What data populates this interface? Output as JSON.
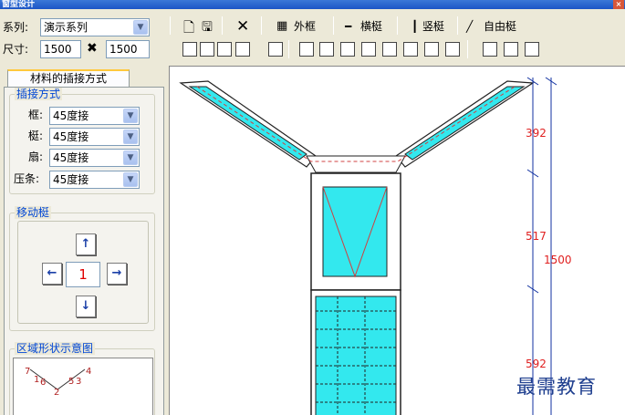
{
  "window": {
    "title": "窗型设计",
    "close": "×"
  },
  "series": {
    "label": "系列:",
    "value": "演示系列"
  },
  "size": {
    "label": "尺寸:",
    "width": "1500",
    "times": "✖",
    "height": "1500"
  },
  "toolbar": {
    "outer_frame": "外框",
    "horizontal": "横梃",
    "vertical": "竖梃",
    "free": "自由梃"
  },
  "tab": {
    "label": "材料的插接方式"
  },
  "joins": {
    "title": "插接方式",
    "rows": [
      {
        "label": "框:",
        "value": "45度接"
      },
      {
        "label": "梃:",
        "value": "45度接"
      },
      {
        "label": "扇:",
        "value": "45度接"
      },
      {
        "label": "压条:",
        "value": "45度接"
      }
    ]
  },
  "move": {
    "title": "移动梃",
    "value": "1"
  },
  "region": {
    "title": "区域形状示意图",
    "numbers": [
      "7",
      "1",
      "6",
      "2",
      "5",
      "3",
      "4"
    ]
  },
  "dimensions": {
    "d1": "392",
    "d2": "517",
    "d3": "592",
    "total": "1500"
  },
  "watermark": "最需教育",
  "colors": {
    "glass": "#33e8ee",
    "dim": "#e02020"
  }
}
